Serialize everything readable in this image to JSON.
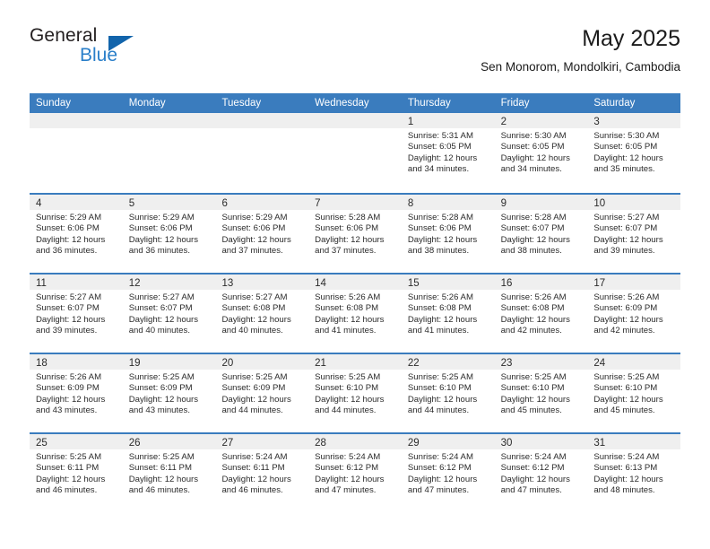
{
  "brand": {
    "name_part1": "General",
    "name_part2": "Blue",
    "triangle_color": "#1264ab",
    "blue_color": "#2a7fc9"
  },
  "header": {
    "title": "May 2025",
    "location": "Sen Monorom, Mondolkiri, Cambodia"
  },
  "theme": {
    "header_blue": "#3a7cbe",
    "day_band_gray": "#efefef",
    "text_color": "#2b2b2b"
  },
  "weekdays": [
    "Sunday",
    "Monday",
    "Tuesday",
    "Wednesday",
    "Thursday",
    "Friday",
    "Saturday"
  ],
  "weeks": [
    [
      {
        "day": "",
        "sunrise": "",
        "sunset": "",
        "daylight1": "",
        "daylight2": ""
      },
      {
        "day": "",
        "sunrise": "",
        "sunset": "",
        "daylight1": "",
        "daylight2": ""
      },
      {
        "day": "",
        "sunrise": "",
        "sunset": "",
        "daylight1": "",
        "daylight2": ""
      },
      {
        "day": "",
        "sunrise": "",
        "sunset": "",
        "daylight1": "",
        "daylight2": ""
      },
      {
        "day": "1",
        "sunrise": "Sunrise: 5:31 AM",
        "sunset": "Sunset: 6:05 PM",
        "daylight1": "Daylight: 12 hours",
        "daylight2": "and 34 minutes."
      },
      {
        "day": "2",
        "sunrise": "Sunrise: 5:30 AM",
        "sunset": "Sunset: 6:05 PM",
        "daylight1": "Daylight: 12 hours",
        "daylight2": "and 34 minutes."
      },
      {
        "day": "3",
        "sunrise": "Sunrise: 5:30 AM",
        "sunset": "Sunset: 6:05 PM",
        "daylight1": "Daylight: 12 hours",
        "daylight2": "and 35 minutes."
      }
    ],
    [
      {
        "day": "4",
        "sunrise": "Sunrise: 5:29 AM",
        "sunset": "Sunset: 6:06 PM",
        "daylight1": "Daylight: 12 hours",
        "daylight2": "and 36 minutes."
      },
      {
        "day": "5",
        "sunrise": "Sunrise: 5:29 AM",
        "sunset": "Sunset: 6:06 PM",
        "daylight1": "Daylight: 12 hours",
        "daylight2": "and 36 minutes."
      },
      {
        "day": "6",
        "sunrise": "Sunrise: 5:29 AM",
        "sunset": "Sunset: 6:06 PM",
        "daylight1": "Daylight: 12 hours",
        "daylight2": "and 37 minutes."
      },
      {
        "day": "7",
        "sunrise": "Sunrise: 5:28 AM",
        "sunset": "Sunset: 6:06 PM",
        "daylight1": "Daylight: 12 hours",
        "daylight2": "and 37 minutes."
      },
      {
        "day": "8",
        "sunrise": "Sunrise: 5:28 AM",
        "sunset": "Sunset: 6:06 PM",
        "daylight1": "Daylight: 12 hours",
        "daylight2": "and 38 minutes."
      },
      {
        "day": "9",
        "sunrise": "Sunrise: 5:28 AM",
        "sunset": "Sunset: 6:07 PM",
        "daylight1": "Daylight: 12 hours",
        "daylight2": "and 38 minutes."
      },
      {
        "day": "10",
        "sunrise": "Sunrise: 5:27 AM",
        "sunset": "Sunset: 6:07 PM",
        "daylight1": "Daylight: 12 hours",
        "daylight2": "and 39 minutes."
      }
    ],
    [
      {
        "day": "11",
        "sunrise": "Sunrise: 5:27 AM",
        "sunset": "Sunset: 6:07 PM",
        "daylight1": "Daylight: 12 hours",
        "daylight2": "and 39 minutes."
      },
      {
        "day": "12",
        "sunrise": "Sunrise: 5:27 AM",
        "sunset": "Sunset: 6:07 PM",
        "daylight1": "Daylight: 12 hours",
        "daylight2": "and 40 minutes."
      },
      {
        "day": "13",
        "sunrise": "Sunrise: 5:27 AM",
        "sunset": "Sunset: 6:08 PM",
        "daylight1": "Daylight: 12 hours",
        "daylight2": "and 40 minutes."
      },
      {
        "day": "14",
        "sunrise": "Sunrise: 5:26 AM",
        "sunset": "Sunset: 6:08 PM",
        "daylight1": "Daylight: 12 hours",
        "daylight2": "and 41 minutes."
      },
      {
        "day": "15",
        "sunrise": "Sunrise: 5:26 AM",
        "sunset": "Sunset: 6:08 PM",
        "daylight1": "Daylight: 12 hours",
        "daylight2": "and 41 minutes."
      },
      {
        "day": "16",
        "sunrise": "Sunrise: 5:26 AM",
        "sunset": "Sunset: 6:08 PM",
        "daylight1": "Daylight: 12 hours",
        "daylight2": "and 42 minutes."
      },
      {
        "day": "17",
        "sunrise": "Sunrise: 5:26 AM",
        "sunset": "Sunset: 6:09 PM",
        "daylight1": "Daylight: 12 hours",
        "daylight2": "and 42 minutes."
      }
    ],
    [
      {
        "day": "18",
        "sunrise": "Sunrise: 5:26 AM",
        "sunset": "Sunset: 6:09 PM",
        "daylight1": "Daylight: 12 hours",
        "daylight2": "and 43 minutes."
      },
      {
        "day": "19",
        "sunrise": "Sunrise: 5:25 AM",
        "sunset": "Sunset: 6:09 PM",
        "daylight1": "Daylight: 12 hours",
        "daylight2": "and 43 minutes."
      },
      {
        "day": "20",
        "sunrise": "Sunrise: 5:25 AM",
        "sunset": "Sunset: 6:09 PM",
        "daylight1": "Daylight: 12 hours",
        "daylight2": "and 44 minutes."
      },
      {
        "day": "21",
        "sunrise": "Sunrise: 5:25 AM",
        "sunset": "Sunset: 6:10 PM",
        "daylight1": "Daylight: 12 hours",
        "daylight2": "and 44 minutes."
      },
      {
        "day": "22",
        "sunrise": "Sunrise: 5:25 AM",
        "sunset": "Sunset: 6:10 PM",
        "daylight1": "Daylight: 12 hours",
        "daylight2": "and 44 minutes."
      },
      {
        "day": "23",
        "sunrise": "Sunrise: 5:25 AM",
        "sunset": "Sunset: 6:10 PM",
        "daylight1": "Daylight: 12 hours",
        "daylight2": "and 45 minutes."
      },
      {
        "day": "24",
        "sunrise": "Sunrise: 5:25 AM",
        "sunset": "Sunset: 6:10 PM",
        "daylight1": "Daylight: 12 hours",
        "daylight2": "and 45 minutes."
      }
    ],
    [
      {
        "day": "25",
        "sunrise": "Sunrise: 5:25 AM",
        "sunset": "Sunset: 6:11 PM",
        "daylight1": "Daylight: 12 hours",
        "daylight2": "and 46 minutes."
      },
      {
        "day": "26",
        "sunrise": "Sunrise: 5:25 AM",
        "sunset": "Sunset: 6:11 PM",
        "daylight1": "Daylight: 12 hours",
        "daylight2": "and 46 minutes."
      },
      {
        "day": "27",
        "sunrise": "Sunrise: 5:24 AM",
        "sunset": "Sunset: 6:11 PM",
        "daylight1": "Daylight: 12 hours",
        "daylight2": "and 46 minutes."
      },
      {
        "day": "28",
        "sunrise": "Sunrise: 5:24 AM",
        "sunset": "Sunset: 6:12 PM",
        "daylight1": "Daylight: 12 hours",
        "daylight2": "and 47 minutes."
      },
      {
        "day": "29",
        "sunrise": "Sunrise: 5:24 AM",
        "sunset": "Sunset: 6:12 PM",
        "daylight1": "Daylight: 12 hours",
        "daylight2": "and 47 minutes."
      },
      {
        "day": "30",
        "sunrise": "Sunrise: 5:24 AM",
        "sunset": "Sunset: 6:12 PM",
        "daylight1": "Daylight: 12 hours",
        "daylight2": "and 47 minutes."
      },
      {
        "day": "31",
        "sunrise": "Sunrise: 5:24 AM",
        "sunset": "Sunset: 6:13 PM",
        "daylight1": "Daylight: 12 hours",
        "daylight2": "and 48 minutes."
      }
    ]
  ]
}
